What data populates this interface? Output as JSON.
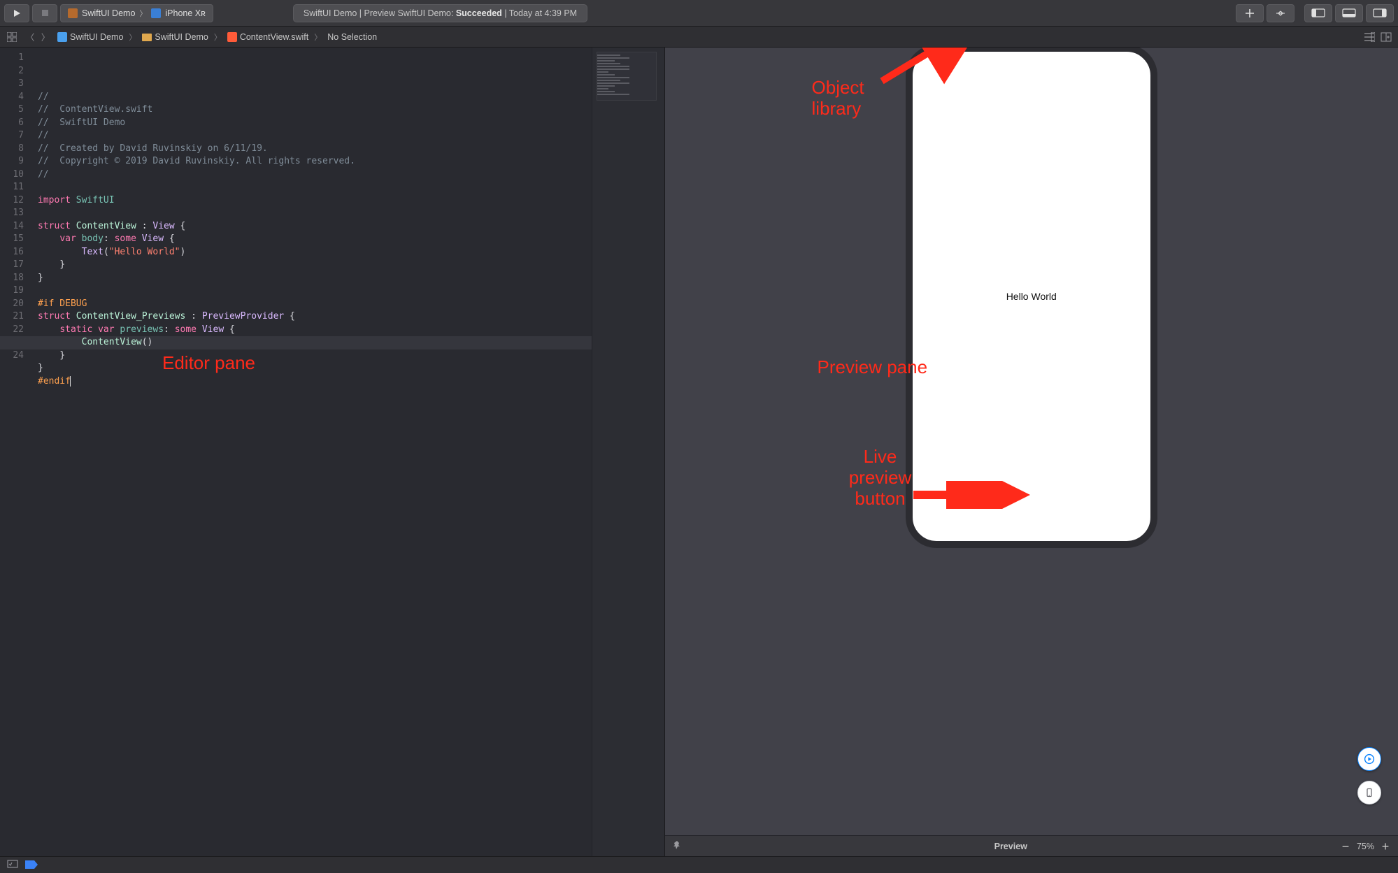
{
  "toolbar": {
    "scheme_app": "SwiftUI Demo",
    "scheme_device": "iPhone Xʀ",
    "status_prefix": "SwiftUI Demo | Preview SwiftUI Demo:",
    "status_result": "Succeeded",
    "status_suffix": "| Today at 4:39 PM"
  },
  "breadcrumb": {
    "items": [
      "SwiftUI Demo",
      "SwiftUI Demo",
      "ContentView.swift",
      "No Selection"
    ]
  },
  "editor": {
    "annotation": "Editor pane",
    "lines": [
      "//",
      "//  ContentView.swift",
      "//  SwiftUI Demo",
      "//",
      "//  Created by David Ruvinskiy on 6/11/19.",
      "//  Copyright © 2019 David Ruvinskiy. All rights reserved.",
      "//",
      "",
      "import SwiftUI",
      "",
      "struct ContentView : View {",
      "    var body: some View {",
      "        Text(\"Hello World\")",
      "    }",
      "}",
      "",
      "#if DEBUG",
      "struct ContentView_Previews : PreviewProvider {",
      "    static var previews: some View {",
      "        ContentView()",
      "    }",
      "}",
      "#endif",
      ""
    ],
    "line_count": 24,
    "highlighted_line": 23
  },
  "preview": {
    "device_text": "Hello World",
    "footer_title": "Preview",
    "zoom_label": "75%",
    "annotation_pane": "Preview pane",
    "annotation_lib_l1": "Object",
    "annotation_lib_l2": "library",
    "annotation_live_l1": "Live",
    "annotation_live_l2": "preview",
    "annotation_live_l3": "button"
  }
}
